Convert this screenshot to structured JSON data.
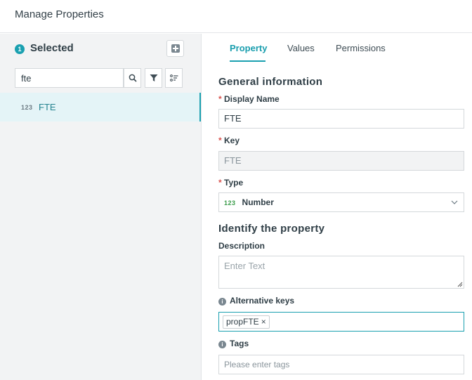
{
  "header": {
    "title": "Manage Properties"
  },
  "left": {
    "selected_count": "1",
    "selected_label": "Selected",
    "search_value": "fte",
    "items": [
      {
        "type_icon": "123",
        "name": "FTE"
      }
    ]
  },
  "tabs": [
    {
      "label": "Property",
      "active": true
    },
    {
      "label": "Values",
      "active": false
    },
    {
      "label": "Permissions",
      "active": false
    }
  ],
  "form": {
    "general_title": "General information",
    "display_name": {
      "label": "Display Name",
      "value": "FTE",
      "required": "*"
    },
    "key": {
      "label": "Key",
      "value": "FTE",
      "required": "*"
    },
    "type": {
      "label": "Type",
      "icon": "123",
      "value": "Number",
      "required": "*"
    },
    "identify_title": "Identify the property",
    "description": {
      "label": "Description",
      "placeholder": "Enter Text"
    },
    "alternative_keys": {
      "label": "Alternative keys",
      "info": "i",
      "chips": [
        "propFTE"
      ],
      "remove": "×"
    },
    "tags": {
      "label": "Tags",
      "info": "i",
      "placeholder": "Please enter tags"
    }
  },
  "colors": {
    "accent": "#1aa0b0",
    "required": "#d9534f",
    "number_icon": "#3a9c4a"
  },
  "icons": [
    "plus-square-icon",
    "search-icon",
    "filter-icon",
    "sort-icon",
    "chevron-down-icon",
    "info-icon",
    "close-icon"
  ]
}
